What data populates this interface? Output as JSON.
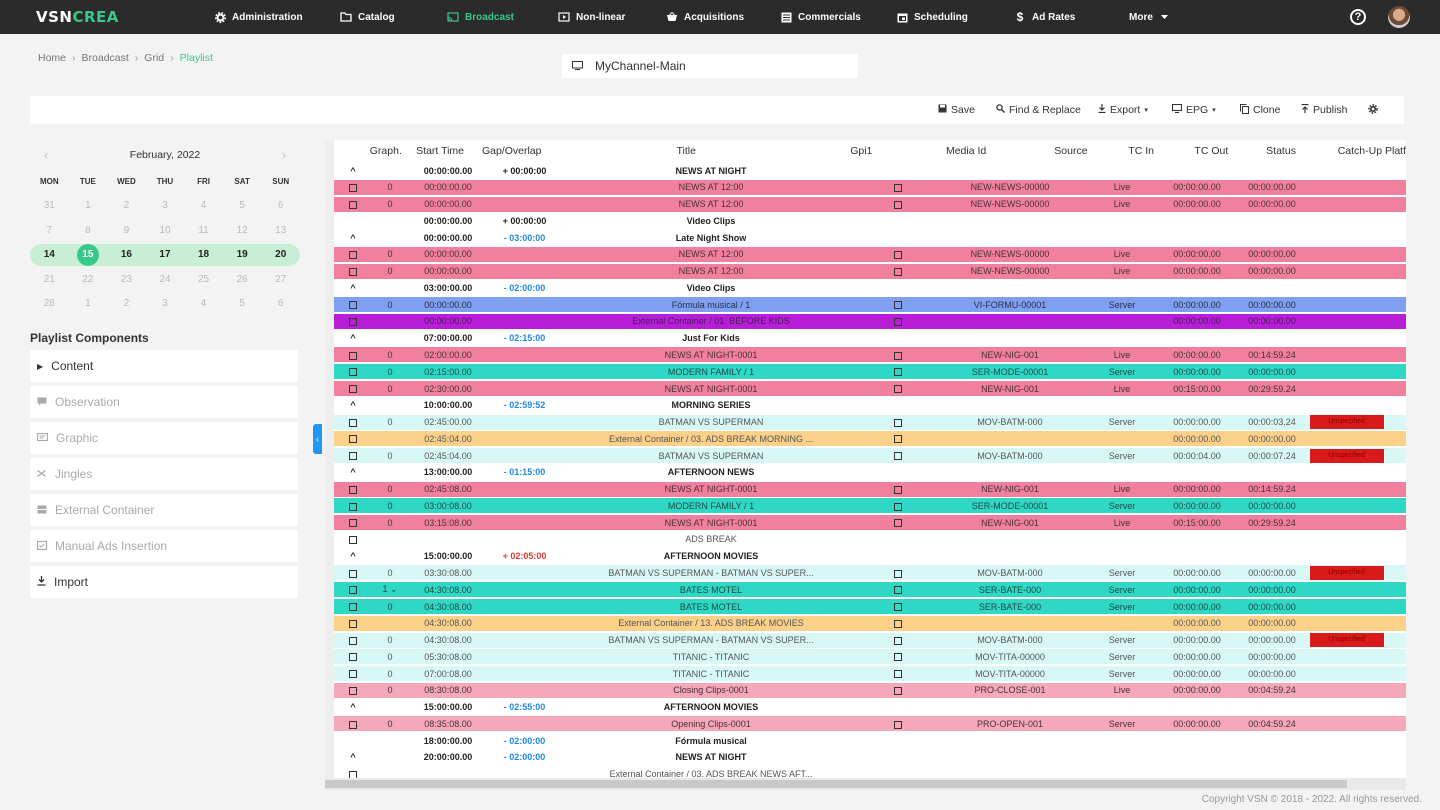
{
  "brand": {
    "logo_a": "VSN",
    "logo_b": "CREA"
  },
  "nav": [
    {
      "label": "Administration",
      "icon": "gear-icon"
    },
    {
      "label": "Catalog",
      "icon": "folder-icon"
    },
    {
      "label": "Broadcast",
      "icon": "cast-icon"
    },
    {
      "label": "Non-linear",
      "icon": "play-icon"
    },
    {
      "label": "Acquisitions",
      "icon": "basket-icon"
    },
    {
      "label": "Commercials",
      "icon": "list-icon"
    },
    {
      "label": "Scheduling",
      "icon": "calendar-icon"
    },
    {
      "label": "Ad Rates",
      "icon": "dollar-icon"
    },
    {
      "label": "More",
      "icon": "caret-down-icon"
    }
  ],
  "breadcrumb": [
    "Home",
    "Broadcast",
    "Grid",
    "Playlist"
  ],
  "channel": "MyChannel-Main",
  "toolbar": {
    "save": "Save",
    "find_replace": "Find & Replace",
    "export": "Export",
    "epg": "EPG",
    "clone": "Clone",
    "publish": "Publish"
  },
  "calendar": {
    "title": "February, 2022",
    "dows": [
      "MON",
      "TUE",
      "WED",
      "THU",
      "FRI",
      "SAT",
      "SUN"
    ],
    "weeks": [
      [
        "31",
        "1",
        "2",
        "3",
        "4",
        "5",
        "6"
      ],
      [
        "7",
        "8",
        "9",
        "10",
        "11",
        "12",
        "13"
      ],
      [
        "14",
        "15",
        "16",
        "17",
        "18",
        "19",
        "20"
      ],
      [
        "21",
        "22",
        "23",
        "24",
        "25",
        "26",
        "27"
      ],
      [
        "28",
        "1",
        "2",
        "3",
        "4",
        "5",
        "6"
      ]
    ],
    "today": "15"
  },
  "components": {
    "title": "Playlist Components",
    "items": [
      "Content",
      "Observation",
      "Graphic",
      "Jingles",
      "External Container",
      "Manual Ads Insertion",
      "Import"
    ]
  },
  "columns": [
    "Graph.",
    "Start Time",
    "Gap/Overlap",
    "Title",
    "Gpi1",
    "Media Id",
    "Source",
    "TC In",
    "TC Out",
    "Status",
    "Catch-Up Platf"
  ],
  "rows": [
    {
      "k": "h",
      "start": "00:00:00.00",
      "gap": "+ 00:00:00",
      "gt": "zero",
      "title": "NEWS AT NIGHT",
      "caret": true
    },
    {
      "k": "pink",
      "graph": "0",
      "start": "00:00:00.00",
      "title": "NEWS AT 12:00",
      "gpi": true,
      "media": "NEW-NEWS-00000",
      "src": "Live",
      "tcin": "00:00:00.00",
      "tcout": "00:00:00.00"
    },
    {
      "k": "pink",
      "graph": "0",
      "start": "00:00:00.00",
      "title": "NEWS AT 12:00",
      "gpi": true,
      "media": "NEW-NEWS-00000",
      "src": "Live",
      "tcin": "00:00:00.00",
      "tcout": "00:00:00.00"
    },
    {
      "k": "h",
      "start": "00:00:00.00",
      "gap": "+ 00:00:00",
      "gt": "zero",
      "title": "Video Clips",
      "caret": false
    },
    {
      "k": "h",
      "start": "00:00:00.00",
      "gap": "- 03:00:00",
      "gt": "neg",
      "title": "Late Night Show",
      "caret": true
    },
    {
      "k": "pink",
      "graph": "0",
      "start": "00:00:00.00",
      "title": "NEWS AT 12:00",
      "gpi": true,
      "media": "NEW-NEWS-00000",
      "src": "Live",
      "tcin": "00:00:00.00",
      "tcout": "00:00:00.00"
    },
    {
      "k": "pink",
      "graph": "0",
      "start": "00:00:00.00",
      "title": "NEWS AT 12:00",
      "gpi": true,
      "media": "NEW-NEWS-00000",
      "src": "Live",
      "tcin": "00:00:00.00",
      "tcout": "00:00:00.00"
    },
    {
      "k": "h",
      "start": "03:00:00.00",
      "gap": "- 02:00:00",
      "gt": "neg",
      "title": "Video Clips",
      "caret": true
    },
    {
      "k": "blue",
      "graph": "0",
      "start": "00:00:00.00",
      "title": "Fórmula musical / 1",
      "gpi": true,
      "media": "VI-FORMU-00001",
      "src": "Server",
      "tcin": "00:00:00.00",
      "tcout": "00:00:00.00"
    },
    {
      "k": "purple",
      "graph": "",
      "start": "00:00:00.00",
      "title": "External Container / 01. BEFORE KIDS",
      "gpi": true,
      "media": "",
      "src": "",
      "tcin": "00:00:00.00",
      "tcout": "00:00:00.00"
    },
    {
      "k": "h",
      "start": "07:00:00.00",
      "gap": "- 02:15:00",
      "gt": "neg",
      "title": "Just For Kids",
      "caret": true
    },
    {
      "k": "pink",
      "graph": "0",
      "start": "02:00:00.00",
      "title": "NEWS AT NIGHT-0001",
      "gpi": true,
      "media": "NEW-NIG-001",
      "src": "Live",
      "tcin": "00:00:00.00",
      "tcout": "00:14:59.24"
    },
    {
      "k": "teal",
      "graph": "0",
      "start": "02:15:00.00",
      "title": "MODERN FAMILY / 1",
      "gpi": true,
      "media": "SER-MODE-00001",
      "src": "Server",
      "tcin": "00:00:00.00",
      "tcout": "00:00:00.00"
    },
    {
      "k": "pink",
      "graph": "0",
      "start": "02:30:00.00",
      "title": "NEWS AT NIGHT-0001",
      "gpi": true,
      "media": "NEW-NIG-001",
      "src": "Live",
      "tcin": "00:15:00.00",
      "tcout": "00:29:59.24"
    },
    {
      "k": "h",
      "start": "10:00:00.00",
      "gap": "- 02:59:52",
      "gt": "neg",
      "title": "MORNING SERIES",
      "caret": true
    },
    {
      "k": "cyan",
      "graph": "0",
      "start": "02:45:00.00",
      "title": "BATMAN VS SUPERMAN",
      "gpi": true,
      "media": "MOV-BATM-000",
      "src": "Server",
      "tcin": "00:00:00.00",
      "tcout": "00:00:03.24",
      "status": "Unspecified"
    },
    {
      "k": "orange",
      "graph": "",
      "start": "02:45:04.00",
      "title": "External Container / 03. ADS BREAK MORNING ...",
      "gpi": true,
      "media": "",
      "src": "",
      "tcin": "00:00:00.00",
      "tcout": "00:00:00.00"
    },
    {
      "k": "cyan",
      "graph": "0",
      "start": "02:45:04.00",
      "title": "BATMAN VS SUPERMAN",
      "gpi": true,
      "media": "MOV-BATM-000",
      "src": "Server",
      "tcin": "00:00:04.00",
      "tcout": "00:00:07.24",
      "status": "Unspecified"
    },
    {
      "k": "h",
      "start": "13:00:00.00",
      "gap": "- 01:15:00",
      "gt": "neg",
      "title": "AFTERNOON NEWS",
      "caret": true
    },
    {
      "k": "pink",
      "graph": "0",
      "start": "02:45:08.00",
      "title": "NEWS AT NIGHT-0001",
      "gpi": true,
      "media": "NEW-NIG-001",
      "src": "Live",
      "tcin": "00:00:00.00",
      "tcout": "00:14:59.24"
    },
    {
      "k": "teal",
      "graph": "0",
      "start": "03:00:08.00",
      "title": "MODERN FAMILY / 1",
      "gpi": true,
      "media": "SER-MODE-00001",
      "src": "Server",
      "tcin": "00:00:00.00",
      "tcout": "00:00:00.00"
    },
    {
      "k": "pink",
      "graph": "0",
      "start": "03:15:08.00",
      "title": "NEWS AT NIGHT-0001",
      "gpi": true,
      "media": "NEW-NIG-001",
      "src": "Live",
      "tcin": "00:15:00.00",
      "tcout": "00:29:59.24"
    },
    {
      "k": "white",
      "graph": "",
      "start": "",
      "title": "ADS BREAK",
      "gpi": false,
      "media": "",
      "src": "",
      "tcin": "",
      "tcout": ""
    },
    {
      "k": "h",
      "start": "15:00:00.00",
      "gap": "+ 02:05:00",
      "gt": "pos",
      "title": "AFTERNOON MOVIES",
      "caret": true
    },
    {
      "k": "cyan",
      "graph": "0",
      "start": "03:30:08.00",
      "title": "BATMAN VS SUPERMAN - BATMAN VS SUPER...",
      "gpi": true,
      "media": "MOV-BATM-000",
      "src": "Server",
      "tcin": "00:00:00.00",
      "tcout": "00:00:00.00",
      "status": "Unspecified"
    },
    {
      "k": "teal",
      "graph": "1 ⌄",
      "start": "04:30:08.00",
      "title": "BATES MOTEL",
      "gpi": true,
      "media": "SER-BATE-000",
      "src": "Server",
      "tcin": "00:00:00.00",
      "tcout": "00:00:00.00"
    },
    {
      "k": "teal",
      "graph": "0",
      "start": "04:30:08.00",
      "title": "BATES MOTEL",
      "gpi": true,
      "media": "SER-BATE-000",
      "src": "Server",
      "tcin": "00:00:00.00",
      "tcout": "00:00:00.00"
    },
    {
      "k": "orange",
      "graph": "",
      "start": "04:30:08.00",
      "title": "External Container / 13. ADS BREAK MOVIES",
      "gpi": true,
      "media": "",
      "src": "",
      "tcin": "00:00:00.00",
      "tcout": "00:00:00.00"
    },
    {
      "k": "cyan",
      "graph": "0",
      "start": "04:30:08.00",
      "title": "BATMAN VS SUPERMAN - BATMAN VS SUPER...",
      "gpi": true,
      "media": "MOV-BATM-000",
      "src": "Server",
      "tcin": "00:00:00.00",
      "tcout": "00:00:00.00",
      "status": "Unspecified"
    },
    {
      "k": "cyan",
      "graph": "0",
      "start": "05:30:08.00",
      "title": "TITANIC - TITANIC",
      "gpi": true,
      "media": "MOV-TITA-00000",
      "src": "Server",
      "tcin": "00:00:00.00",
      "tcout": "00:00:00.00"
    },
    {
      "k": "cyan",
      "graph": "0",
      "start": "07:00:08.00",
      "title": "TITANIC - TITANIC",
      "gpi": true,
      "media": "MOV-TITA-00000",
      "src": "Server",
      "tcin": "00:00:00.00",
      "tcout": "00:00:00.00"
    },
    {
      "k": "lightpink",
      "graph": "0",
      "start": "08:30:08.00",
      "title": "Closing Clips-0001",
      "gpi": true,
      "media": "PRO-CLOSE-001",
      "src": "Live",
      "tcin": "00:00:00.00",
      "tcout": "00:04:59.24"
    },
    {
      "k": "h",
      "start": "15:00:00.00",
      "gap": "- 02:55:00",
      "gt": "neg",
      "title": "AFTERNOON MOVIES",
      "caret": true
    },
    {
      "k": "lightpink",
      "graph": "0",
      "start": "08:35:08.00",
      "title": "Opening Clips-0001",
      "gpi": true,
      "media": "PRO-OPEN-001",
      "src": "Server",
      "tcin": "00:00:00.00",
      "tcout": "00:04:59.24"
    },
    {
      "k": "h",
      "start": "18:00:00.00",
      "gap": "- 02:00:00",
      "gt": "neg",
      "title": "Fórmula musical",
      "caret": false
    },
    {
      "k": "h",
      "start": "20:00:00.00",
      "gap": "- 02:00:00",
      "gt": "neg",
      "title": "NEWS AT NIGHT",
      "caret": true
    },
    {
      "k": "white",
      "graph": "",
      "start": "",
      "title": "External Container / 03. ADS BREAK NEWS AFT...",
      "gpi": false,
      "media": "",
      "src": "",
      "tcin": "",
      "tcout": ""
    }
  ],
  "footer": "Copyright VSN © 2018 - 2022. All rights reserved."
}
